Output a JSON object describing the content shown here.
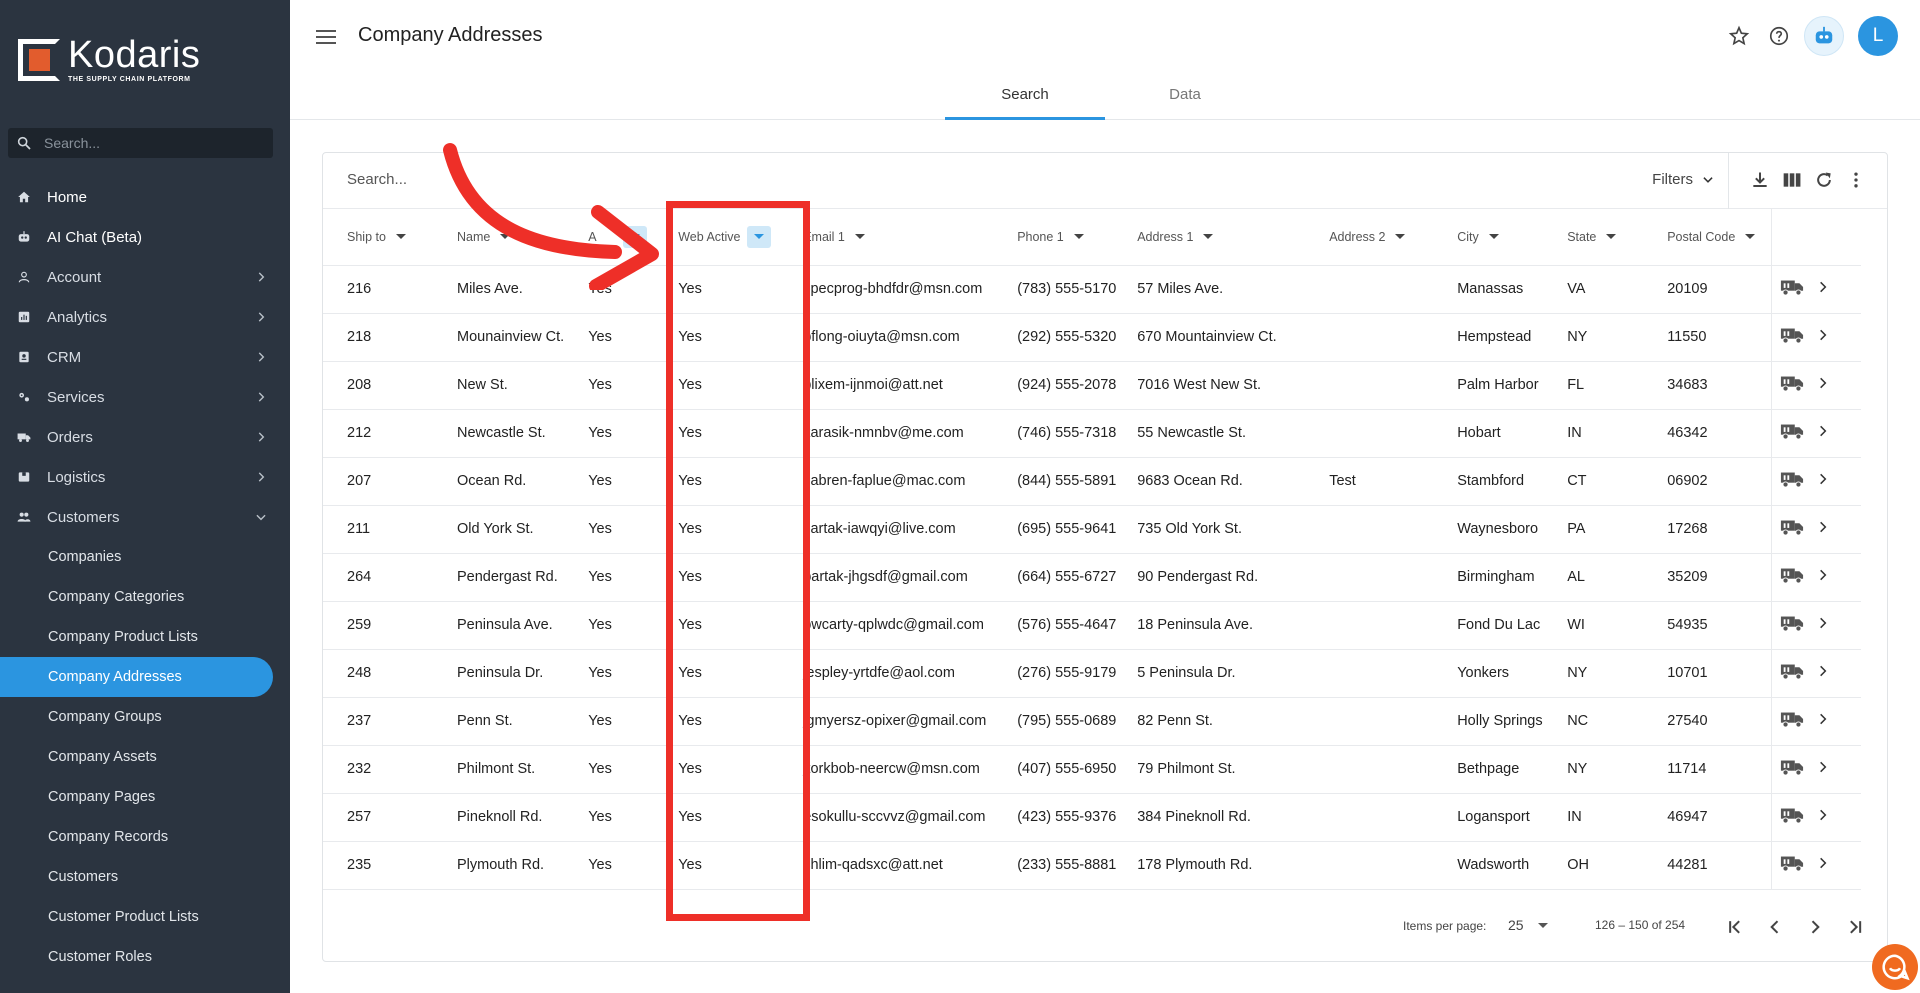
{
  "app": {
    "logo_name": "Kodaris",
    "logo_tagline": "THE SUPPLY CHAIN PLATFORM",
    "brand_color": "#2b95e0",
    "logo_accent": "#e25c2d",
    "sidebar_bg": "#2b3440"
  },
  "sidebar": {
    "search_placeholder": "Search...",
    "items": [
      {
        "label": "Home",
        "icon": "home-icon"
      },
      {
        "label": "AI Chat (Beta)",
        "icon": "bot-icon"
      },
      {
        "label": "Account",
        "icon": "person-icon"
      },
      {
        "label": "Analytics",
        "icon": "analytics-icon"
      },
      {
        "label": "CRM",
        "icon": "crm-icon"
      },
      {
        "label": "Services",
        "icon": "services-icon"
      },
      {
        "label": "Orders",
        "icon": "truck-icon"
      },
      {
        "label": "Logistics",
        "icon": "box-icon"
      },
      {
        "label": "Customers",
        "icon": "people-icon"
      }
    ],
    "sub_items": [
      "Companies",
      "Company Categories",
      "Company Product Lists",
      "Company Addresses",
      "Company Groups",
      "Company Assets",
      "Company Pages",
      "Company Records",
      "Customers",
      "Customer Product Lists",
      "Customer Roles"
    ],
    "active_sub_item": "Company Addresses"
  },
  "header": {
    "title": "Company Addresses",
    "avatar_initial": "L",
    "tabs": [
      {
        "label": "Search",
        "active": true
      },
      {
        "label": "Data",
        "active": false
      }
    ]
  },
  "toolbar": {
    "search_placeholder": "Search...",
    "filters_label": "Filters"
  },
  "table": {
    "columns": [
      "Ship to",
      "Name",
      "A",
      "Web Active",
      "Email 1",
      "Phone 1",
      "Address 1",
      "Address 2",
      "City",
      "State",
      "Postal Code"
    ],
    "rows": [
      [
        "216",
        "Miles Ave.",
        "Yes",
        "Yes",
        "specprog-bhdfdr@msn.com",
        "(783) 555-5170",
        "57 Miles Ave.",
        "",
        "Manassas",
        "VA",
        "20109"
      ],
      [
        "218",
        "Mounainview Ct.",
        "Yes",
        "Yes",
        "bflong-oiuyta@msn.com",
        "(292) 555-5320",
        "670 Mountainview Ct.",
        "",
        "Hempstead",
        "NY",
        "11550"
      ],
      [
        "208",
        "New St.",
        "Yes",
        "Yes",
        "blixem-ijnmoi@att.net",
        "(924) 555-2078",
        "7016 West New St.",
        "",
        "Palm Harbor",
        "FL",
        "34683"
      ],
      [
        "212",
        "Newcastle St.",
        "Yes",
        "Yes",
        "karasik-nmnbv@me.com",
        "(746) 555-7318",
        "55 Newcastle St.",
        "",
        "Hobart",
        "IN",
        "46342"
      ],
      [
        "207",
        "Ocean Rd.",
        "Yes",
        "Yes",
        "sabren-faplue@mac.com",
        "(844) 555-5891",
        "9683 Ocean Rd.",
        "Test",
        "Stambford",
        "CT",
        "06902"
      ],
      [
        "211",
        "Old York St.",
        "Yes",
        "Yes",
        "sartak-iawqyi@live.com",
        "(695) 555-9641",
        "735 Old York St.",
        "",
        "Waynesboro",
        "PA",
        "17268"
      ],
      [
        "264",
        "Pendergast Rd.",
        "Yes",
        "Yes",
        "bartak-jhgsdf@gmail.com",
        "(664) 555-6727",
        "90 Pendergast Rd.",
        "",
        "Birmingham",
        "AL",
        "35209"
      ],
      [
        "259",
        "Peninsula Ave.",
        "Yes",
        "Yes",
        "bwcarty-qplwdc@gmail.com",
        "(576) 555-4647",
        "18 Peninsula Ave.",
        "",
        "Fond Du Lac",
        "WI",
        "54935"
      ],
      [
        "248",
        "Peninsula Dr.",
        "Yes",
        "Yes",
        "jespley-yrtdfe@aol.com",
        "(276) 555-9179",
        "5 Peninsula Dr.",
        "",
        "Yonkers",
        "NY",
        "10701"
      ],
      [
        "237",
        "Penn St.",
        "Yes",
        "Yes",
        "jgmyersz-opixer@gmail.com",
        "(795) 555-0689",
        "82 Penn St.",
        "",
        "Holly Springs",
        "NC",
        "27540"
      ],
      [
        "232",
        "Philmont St.",
        "Yes",
        "Yes",
        "jtorkbob-neercw@msn.com",
        "(407) 555-6950",
        "79 Philmont St.",
        "",
        "Bethpage",
        "NY",
        "11714"
      ],
      [
        "257",
        "Pineknoll Rd.",
        "Yes",
        "Yes",
        "esokullu-sccvvz@gmail.com",
        "(423) 555-9376",
        "384 Pineknoll Rd.",
        "",
        "Logansport",
        "IN",
        "46947"
      ],
      [
        "235",
        "Plymouth Rd.",
        "Yes",
        "Yes",
        "chlim-qadsxc@att.net",
        "(233) 555-8881",
        "178 Plymouth Rd.",
        "",
        "Wadsworth",
        "OH",
        "44281"
      ]
    ]
  },
  "paginator": {
    "items_per_page_label": "Items per page:",
    "items_per_page": "25",
    "range": "126 – 150 of 254"
  },
  "annotation": {
    "color": "#ee2f28"
  }
}
